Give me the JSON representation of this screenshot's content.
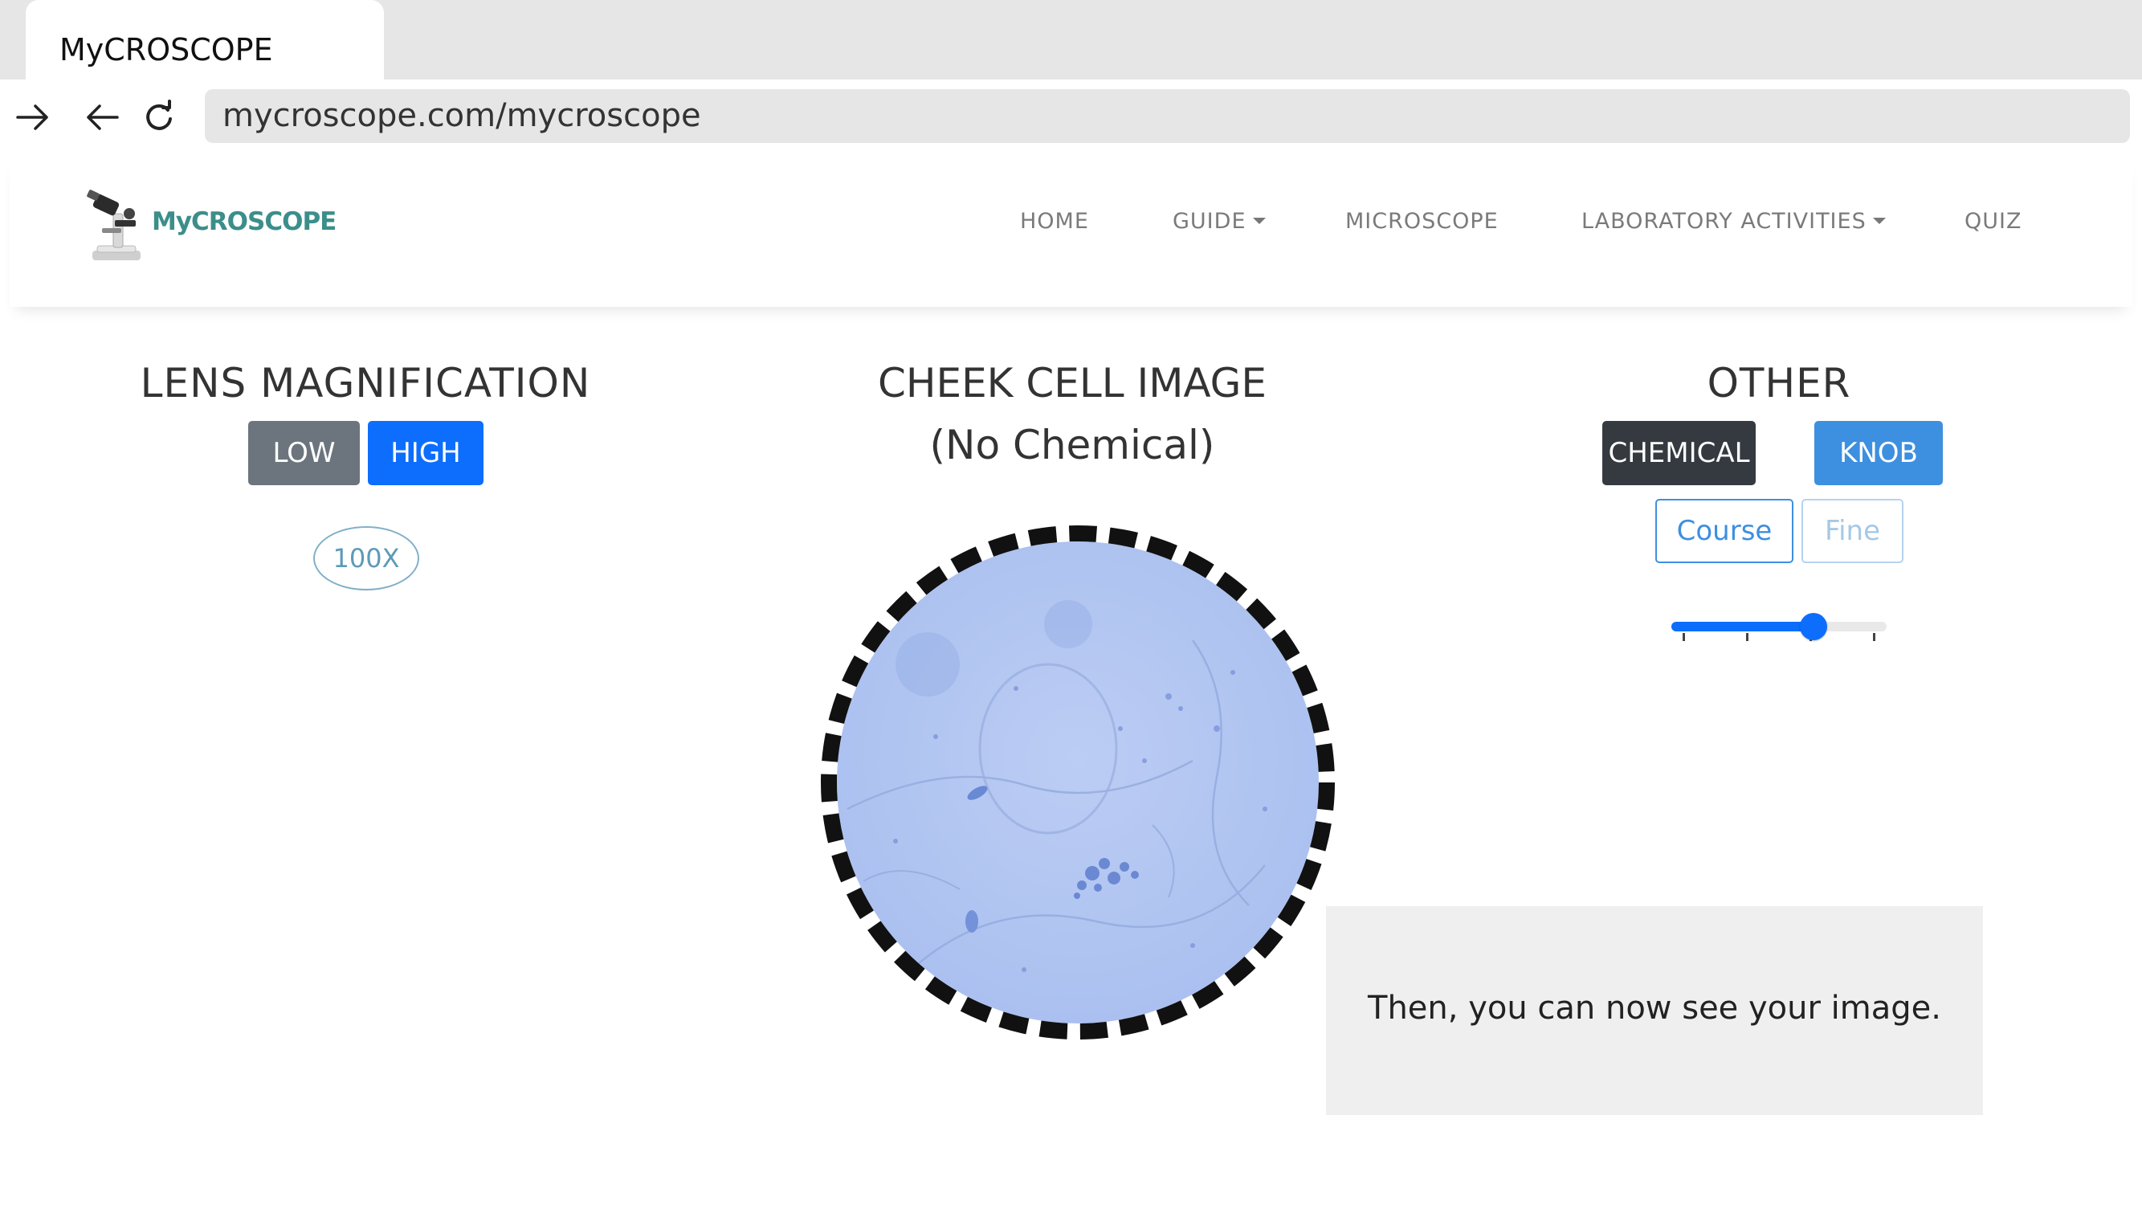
{
  "browser": {
    "tab_title": "MyCROSCOPE",
    "url": "mycroscope.com/mycroscope",
    "icons": [
      "forward-icon",
      "back-icon",
      "reload-icon"
    ]
  },
  "nav": {
    "brand": "MyCROSCOPE",
    "items": [
      {
        "label": "HOME",
        "dropdown": false
      },
      {
        "label": "GUIDE",
        "dropdown": true
      },
      {
        "label": "MICROSCOPE",
        "dropdown": false
      },
      {
        "label": "LABORATORY ACTIVITIES",
        "dropdown": true
      },
      {
        "label": "QUIZ",
        "dropdown": false
      }
    ]
  },
  "lens": {
    "title": "LENS MAGNIFICATION",
    "buttons": [
      {
        "label": "LOW",
        "active": false
      },
      {
        "label": "HIGH",
        "active": true
      }
    ],
    "magnification": "100X"
  },
  "cheek": {
    "title_line1": "CHEEK CELL IMAGE",
    "title_line2": "(No Chemical)"
  },
  "other": {
    "title": "OTHER",
    "buttons": [
      {
        "label": "CHEMICAL",
        "active": true
      },
      {
        "label": "KNOB",
        "active": true
      }
    ],
    "knob_buttons": [
      {
        "label": "Course",
        "active": true
      },
      {
        "label": "Fine",
        "active": false
      }
    ],
    "focus_level": 0.66
  },
  "message": "Then, you can now see your image.",
  "colors": {
    "primary": "#0d6efd",
    "secondary": "#6c757d",
    "dark": "#343a40",
    "knob": "#3d8fe0",
    "brand": "#3c8e8a",
    "cell_field": "#b3c7f2"
  }
}
